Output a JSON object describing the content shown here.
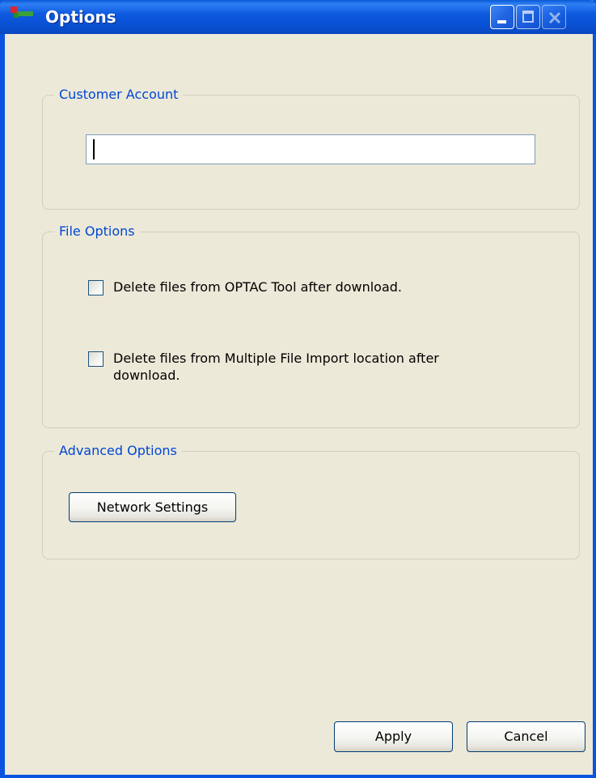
{
  "window": {
    "title": "Options",
    "controls": [
      "minimize-icon",
      "maximize-icon",
      "close-icon"
    ]
  },
  "customer_account": {
    "legend": "Customer Account",
    "input_value": ""
  },
  "file_options": {
    "legend": "File Options",
    "checkboxes": [
      {
        "label": "Delete files from OPTAC Tool after download.",
        "checked": false
      },
      {
        "label": "Delete files from Multiple File Import location after download.",
        "checked": false
      }
    ]
  },
  "advanced_options": {
    "legend": "Advanced Options",
    "network_settings_label": "Network Settings"
  },
  "footer": {
    "apply_label": "Apply",
    "cancel_label": "Cancel"
  },
  "colors": {
    "titlebar": "#0a54e0",
    "dialog_bg": "#ece9d8",
    "legend_text": "#0046d5",
    "input_border": "#7f9db9",
    "button_border": "#003c74"
  }
}
